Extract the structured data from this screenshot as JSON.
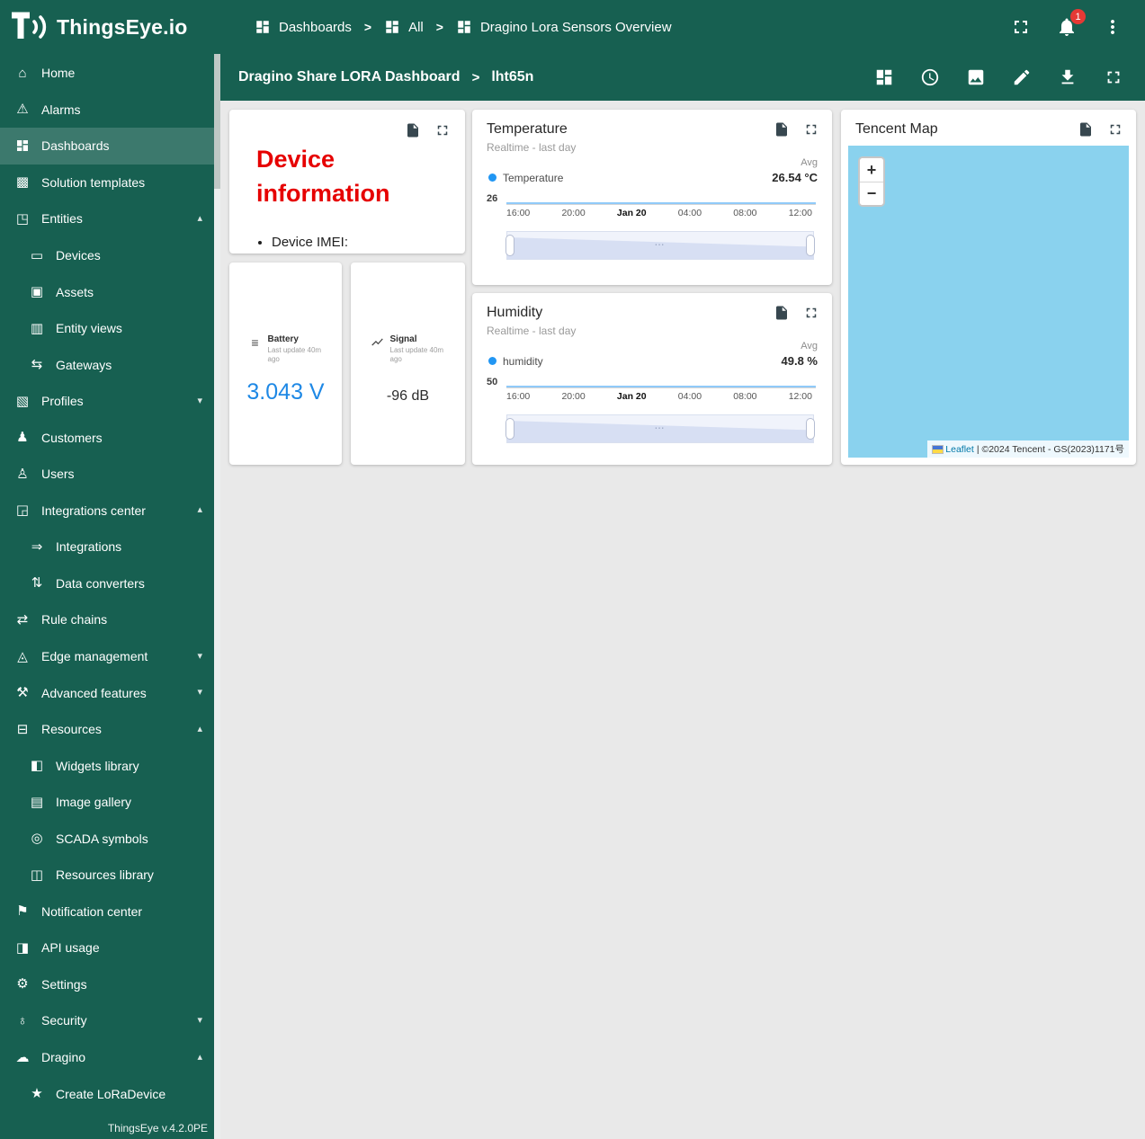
{
  "app": {
    "name": "ThingsEye.io",
    "version_label": "ThingsEye v.4.2.0PE"
  },
  "topbar": {
    "breadcrumbs": [
      "Dashboards",
      "All",
      "Dragino Lora Sensors Overview"
    ],
    "separator": ">",
    "actions": [
      "fullscreen-icon",
      "notifications-bell-icon",
      "more-vert-icon"
    ],
    "notification_count": "1"
  },
  "sidebar": {
    "items": [
      {
        "label": "Home",
        "icon": "home-icon"
      },
      {
        "label": "Alarms",
        "icon": "alarms-icon"
      },
      {
        "label": "Dashboards",
        "icon": "dashboard-icon",
        "active": true
      },
      {
        "label": "Solution templates",
        "icon": "solution-templates-icon"
      },
      {
        "label": "Entities",
        "icon": "entities-icon",
        "chevron": "up"
      },
      {
        "label": "Devices",
        "icon": "devices-icon",
        "indent": true
      },
      {
        "label": "Assets",
        "icon": "assets-icon",
        "indent": true
      },
      {
        "label": "Entity views",
        "icon": "entity-views-icon",
        "indent": true
      },
      {
        "label": "Gateways",
        "icon": "gateways-icon",
        "indent": true
      },
      {
        "label": "Profiles",
        "icon": "profiles-icon",
        "chevron": "down"
      },
      {
        "label": "Customers",
        "icon": "customers-icon"
      },
      {
        "label": "Users",
        "icon": "users-icon"
      },
      {
        "label": "Integrations center",
        "icon": "integrations-center-icon",
        "chevron": "up"
      },
      {
        "label": "Integrations",
        "icon": "integrations-icon",
        "indent": true
      },
      {
        "label": "Data converters",
        "icon": "data-converters-icon",
        "indent": true
      },
      {
        "label": "Rule chains",
        "icon": "rule-chains-icon"
      },
      {
        "label": "Edge management",
        "icon": "edge-management-icon",
        "chevron": "down"
      },
      {
        "label": "Advanced features",
        "icon": "advanced-features-icon",
        "chevron": "down"
      },
      {
        "label": "Resources",
        "icon": "resources-icon",
        "chevron": "up"
      },
      {
        "label": "Widgets library",
        "icon": "widgets-library-icon",
        "indent": true
      },
      {
        "label": "Image gallery",
        "icon": "image-gallery-icon",
        "indent": true
      },
      {
        "label": "SCADA symbols",
        "icon": "scada-symbols-icon",
        "indent": true
      },
      {
        "label": "Resources library",
        "icon": "resources-library-icon",
        "indent": true
      },
      {
        "label": "Notification center",
        "icon": "notification-center-icon"
      },
      {
        "label": "API usage",
        "icon": "api-usage-icon"
      },
      {
        "label": "Settings",
        "icon": "settings-icon"
      },
      {
        "label": "Security",
        "icon": "security-icon",
        "chevron": "down"
      },
      {
        "label": "Dragino",
        "icon": "dragino-icon",
        "chevron": "up"
      },
      {
        "label": "Create LoRaDevice",
        "icon": "star-icon",
        "indent": true
      }
    ]
  },
  "dashboard_toolbar": {
    "title": "Dragino Share LORA Dashboard",
    "separator": ">",
    "state": "lht65n",
    "actions": [
      "dashboard-layouts-icon",
      "timewindow-clock-icon",
      "background-image-icon",
      "edit-pencil-icon",
      "export-download-icon",
      "expand-fullscreen-icon"
    ]
  },
  "widgets": {
    "header_actions": [
      "export-file-icon",
      "expand-widget-icon"
    ],
    "device_info": {
      "title": "Device information",
      "items": [
        "Device IMEI:"
      ]
    },
    "temperature": {
      "title": "Temperature",
      "subtitle": "Realtime - last day",
      "legend_header": "Avg",
      "series_label": "Temperature",
      "series_value": "26.54 °C",
      "y_tick": "26",
      "x_ticks": [
        "16:00",
        "20:00",
        "Jan 20",
        "04:00",
        "08:00",
        "12:00"
      ]
    },
    "humidity": {
      "title": "Humidity",
      "subtitle": "Realtime - last day",
      "legend_header": "Avg",
      "series_label": "humidity",
      "series_value": "49.8 %",
      "y_tick": "50",
      "x_ticks": [
        "16:00",
        "20:00",
        "Jan 20",
        "04:00",
        "08:00",
        "12:00"
      ]
    },
    "battery": {
      "label": "Battery",
      "updated": "Last update 40m ago",
      "value": "3.043 V"
    },
    "signal": {
      "label": "Signal",
      "updated": "Last update 40m ago",
      "value": "-96 dB"
    },
    "map": {
      "title": "Tencent Map",
      "zoom_in": "+",
      "zoom_out": "−",
      "attribution_link": "Leaflet",
      "attribution_text": " | ©2024 Tencent - GS(2023)1171号"
    }
  },
  "chart_data": [
    {
      "type": "line",
      "title": "Temperature",
      "window": "Realtime - last day",
      "series": [
        {
          "name": "Temperature",
          "avg": 26.54,
          "unit": "°C"
        }
      ],
      "x_ticks": [
        "16:00",
        "20:00",
        "Jan 20",
        "04:00",
        "08:00",
        "12:00"
      ],
      "y_ticks": [
        26
      ],
      "legend_position": "top"
    },
    {
      "type": "line",
      "title": "Humidity",
      "window": "Realtime - last day",
      "series": [
        {
          "name": "humidity",
          "avg": 49.8,
          "unit": "%"
        }
      ],
      "x_ticks": [
        "16:00",
        "20:00",
        "Jan 20",
        "04:00",
        "08:00",
        "12:00"
      ],
      "y_ticks": [
        50
      ],
      "legend_position": "top"
    }
  ],
  "colors": {
    "header_teal": "#176051",
    "active_item_overlay": "rgba(255,255,255,0.16)",
    "device_title_red": "#e60000",
    "battery_value_blue": "#1e88e5",
    "series_blue": "#2196f3",
    "map_water_blue": "#8ad2ee",
    "badge_red": "#e53935",
    "leaflet_link_blue": "#0078a8"
  }
}
